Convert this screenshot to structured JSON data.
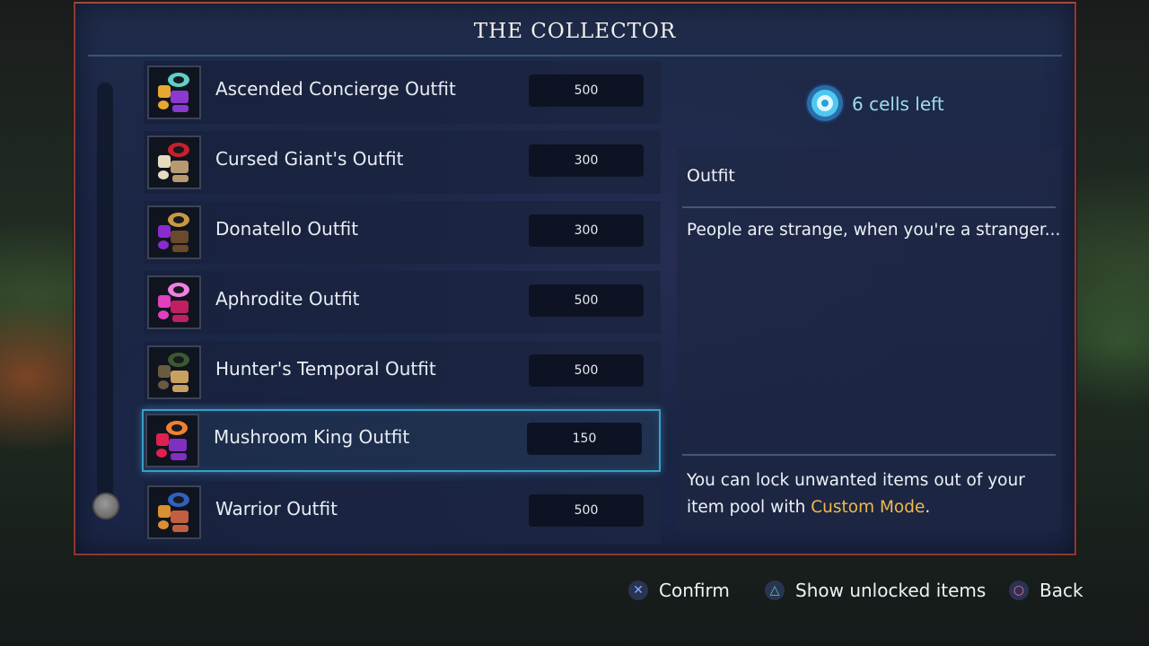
{
  "title": "THE COLLECTOR",
  "cells": {
    "text": "6 cells left",
    "icon": "cell-icon"
  },
  "items": [
    {
      "name": "Ascended Concierge Outfit",
      "price": "500",
      "icon": "outfit-icon",
      "colors": [
        "#e6a830",
        "#5fd0c8",
        "#8a3ad0"
      ]
    },
    {
      "name": "Cursed Giant's Outfit",
      "price": "300",
      "icon": "outfit-icon",
      "colors": [
        "#e8dcc0",
        "#c8202a",
        "#b89a70"
      ]
    },
    {
      "name": "Donatello Outfit",
      "price": "300",
      "icon": "outfit-icon",
      "colors": [
        "#8a2ad0",
        "#c89a40",
        "#6a4a2a"
      ]
    },
    {
      "name": "Aphrodite Outfit",
      "price": "500",
      "icon": "outfit-icon",
      "colors": [
        "#e040c0",
        "#f080e0",
        "#c02060"
      ]
    },
    {
      "name": "Hunter's Temporal Outfit",
      "price": "500",
      "icon": "outfit-icon",
      "colors": [
        "#6a5a40",
        "#3a5a30",
        "#c8a060"
      ]
    },
    {
      "name": "Mushroom King Outfit",
      "price": "150",
      "icon": "outfit-icon",
      "colors": [
        "#e02050",
        "#f08030",
        "#8030c0"
      ]
    },
    {
      "name": "Warrior Outfit",
      "price": "500",
      "icon": "outfit-icon",
      "colors": [
        "#d89030",
        "#3060c0",
        "#c06040"
      ]
    }
  ],
  "selected_index": 5,
  "description": {
    "type": "Outfit",
    "text": "People are strange, when you're a stranger...",
    "hint_prefix": "You can lock unwanted items out of your item pool with ",
    "hint_link": "Custom Mode",
    "hint_suffix": "."
  },
  "footer": {
    "confirm": {
      "label": "Confirm",
      "glyph": "✕",
      "glyph_color": "#7ab0ff"
    },
    "show_unlocked": {
      "label": "Show unlocked items",
      "glyph": "△",
      "glyph_color": "#4fd0a8"
    },
    "back": {
      "label": "Back",
      "glyph": "○",
      "glyph_color": "#ff6a9a"
    }
  }
}
